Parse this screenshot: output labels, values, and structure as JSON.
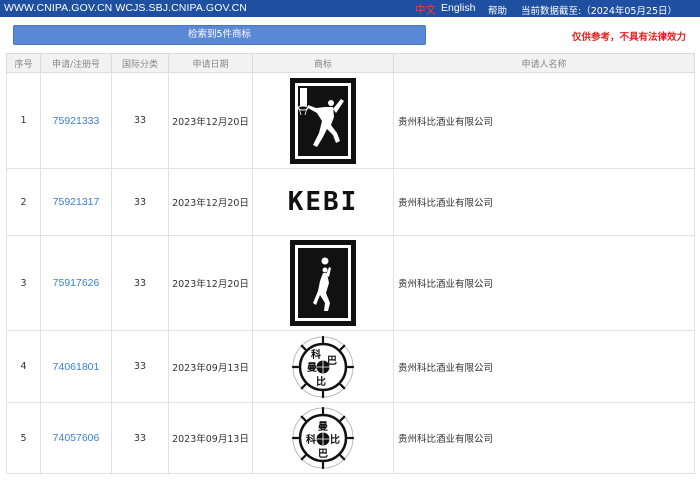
{
  "topbar": {
    "domains": "WWW.CNIPA.GOV.CN WCJS.SBJ.CNIPA.GOV.CN",
    "lang_zh": "中文",
    "lang_en": "English",
    "help": "帮助",
    "data_as_of": "当前数据截至:（2024年05月25日）"
  },
  "toolbar": {
    "result_label": "检索到5件商标",
    "disclaimer": "仅供参考，不具有法律效力"
  },
  "table": {
    "headers": [
      "序号",
      "申请/注册号",
      "国际分类",
      "申请日期",
      "商标",
      "申请人名称"
    ],
    "rows": [
      {
        "index": "1",
        "reg_no": "75921333",
        "class": "33",
        "date": "2023年12月20日",
        "mark": "basketball-dunk-silhouette-logo",
        "applicant": "贵州科比酒业有限公司"
      },
      {
        "index": "2",
        "reg_no": "75921317",
        "class": "33",
        "date": "2023年12月20日",
        "mark_text": "KEBI",
        "applicant": "贵州科比酒业有限公司"
      },
      {
        "index": "3",
        "reg_no": "75917626",
        "class": "33",
        "date": "2023年12月20日",
        "mark": "basketball-shot-silhouette-logo",
        "applicant": "贵州科比酒业有限公司"
      },
      {
        "index": "4",
        "reg_no": "74061801",
        "class": "33",
        "date": "2023年09月13日",
        "mark": "round-seal-logo",
        "mark_chars": [
          "科",
          "巴",
          "曼",
          "比"
        ],
        "applicant": "贵州科比酒业有限公司"
      },
      {
        "index": "5",
        "reg_no": "74057606",
        "class": "33",
        "date": "2023年09月13日",
        "mark": "round-seal-logo",
        "mark_chars": [
          "曼",
          "科",
          "比",
          "巴"
        ],
        "applicant": "贵州科比酒业有限公司"
      }
    ]
  },
  "colors": {
    "topbar_bg": "#1f4fa0",
    "button_bg": "#5b88d6",
    "link": "#3a7fd0",
    "disclaimer": "#e02020",
    "lang_active": "#ff3b30"
  }
}
